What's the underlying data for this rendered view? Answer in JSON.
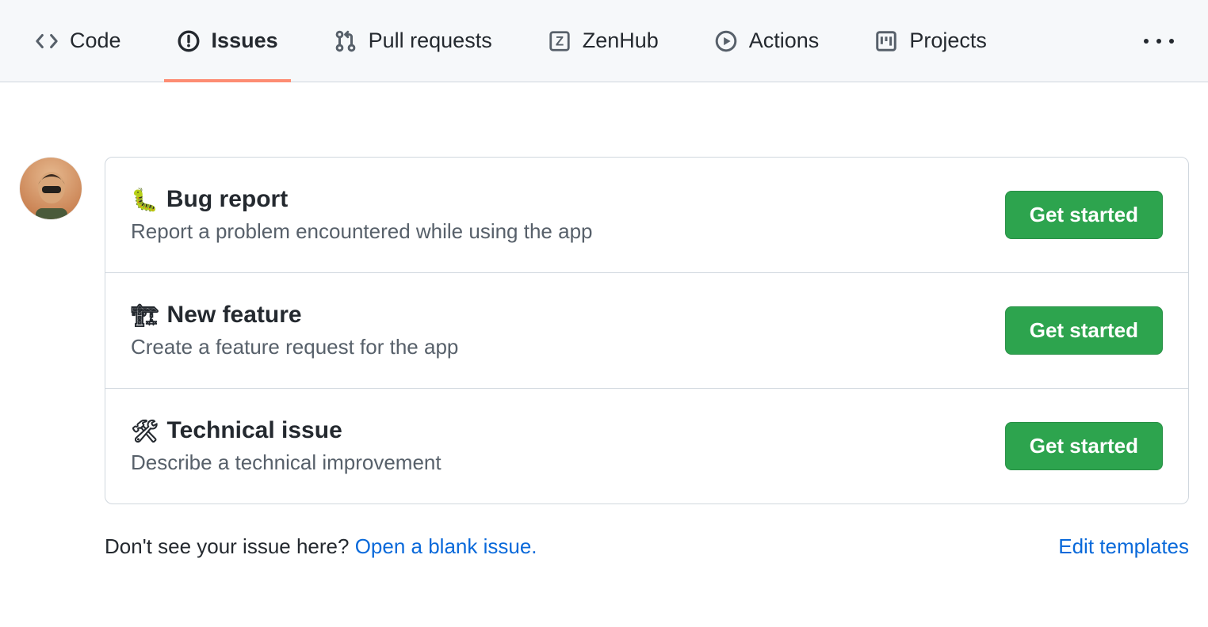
{
  "tabs": [
    {
      "label": "Code",
      "icon": "code"
    },
    {
      "label": "Issues",
      "icon": "issue",
      "active": true
    },
    {
      "label": "Pull requests",
      "icon": "pr"
    },
    {
      "label": "ZenHub",
      "icon": "zenhub"
    },
    {
      "label": "Actions",
      "icon": "play"
    },
    {
      "label": "Projects",
      "icon": "project"
    }
  ],
  "templates": [
    {
      "emoji": "🐛",
      "title": "Bug report",
      "description": "Report a problem encountered while using the app",
      "button": "Get started"
    },
    {
      "emoji": "🏗",
      "title": "New feature",
      "description": "Create a feature request for the app",
      "button": "Get started"
    },
    {
      "emoji": "🛠",
      "title": "Technical issue",
      "description": "Describe a technical improvement",
      "button": "Get started"
    }
  ],
  "footer": {
    "prompt": "Don't see your issue here? ",
    "open_blank": "Open a blank issue.",
    "edit_templates": "Edit templates"
  }
}
